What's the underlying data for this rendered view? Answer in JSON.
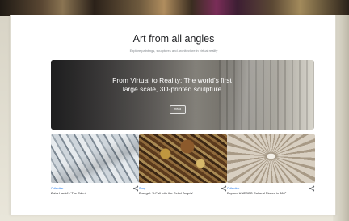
{
  "page": {
    "heading": "Art from all angles",
    "subheading": "Explore paintings, sculptures and architecture in virtual reality"
  },
  "hero": {
    "title": "From Virtual to Reality: The world's first large scale, 3D-printed sculpture",
    "button_label": "Read"
  },
  "cards": [
    {
      "category": "Collection",
      "title": "Zaha Hadid's 'The Eden'",
      "share_icon": "share-icon"
    },
    {
      "category": "Story",
      "title": "Bruegel: 'A Fall with the Rebel Angels'",
      "share_icon": "share-icon"
    },
    {
      "category": "Collection",
      "title": "Explore UNESCO Cultural Places in 360°",
      "share_icon": "share-icon"
    }
  ],
  "colors": {
    "accent": "#1a73e8",
    "text": "#202124",
    "muted": "#80868b"
  }
}
